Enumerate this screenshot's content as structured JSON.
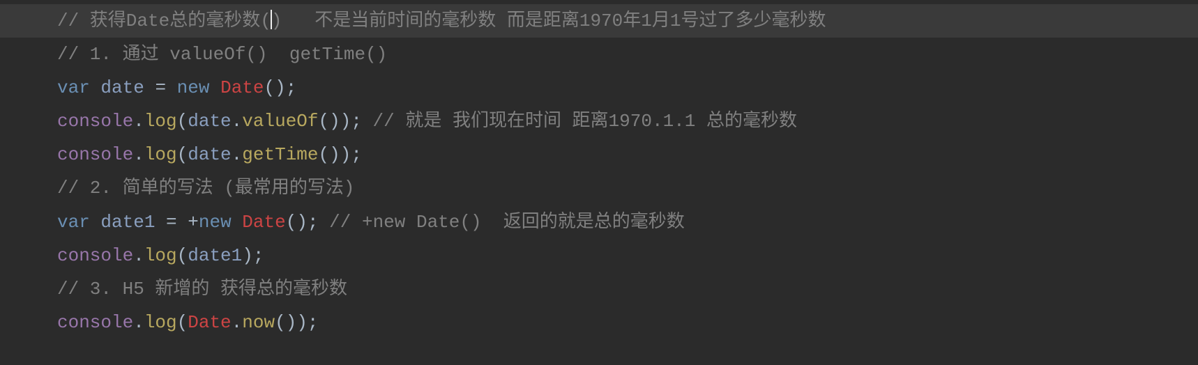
{
  "code": {
    "line1": {
      "c1": "// 获得Date总的毫秒数(",
      "c2": ")   不是当前时间的毫秒数 而是距离1970年1月1号过了多少毫秒数"
    },
    "line2": {
      "comment": "// 1. 通过 valueOf()  getTime()"
    },
    "line3": {
      "kw_var": "var",
      "sp1": " ",
      "name": "date",
      "sp2": " ",
      "eq": "=",
      "sp3": " ",
      "kw_new": "new",
      "sp4": " ",
      "cls": "Date",
      "paren": "()",
      "semi": ";"
    },
    "line4": {
      "obj": "console",
      "dot1": ".",
      "log": "log",
      "open": "(",
      "arg": "date",
      "dot2": ".",
      "method": "valueOf",
      "paren": "()",
      "close": ")",
      "semi": ";",
      "sp": " ",
      "comment": "// 就是 我们现在时间 距离1970.1.1 总的毫秒数"
    },
    "line5": {
      "obj": "console",
      "dot1": ".",
      "log": "log",
      "open": "(",
      "arg": "date",
      "dot2": ".",
      "method": "getTime",
      "paren": "()",
      "close": ")",
      "semi": ";"
    },
    "line6": {
      "comment": "// 2. 简单的写法 (最常用的写法)"
    },
    "line7": {
      "kw_var": "var",
      "sp1": " ",
      "name": "date1",
      "sp2": " ",
      "eq": "=",
      "sp3": " ",
      "plus": "+",
      "kw_new": "new",
      "sp4": " ",
      "cls": "Date",
      "paren": "()",
      "semi": ";",
      "sp5": " ",
      "comment": "// +new Date()  返回的就是总的毫秒数"
    },
    "line8": {
      "obj": "console",
      "dot1": ".",
      "log": "log",
      "open": "(",
      "arg": "date1",
      "close": ")",
      "semi": ";"
    },
    "line9": {
      "comment": "// 3. H5 新增的 获得总的毫秒数"
    },
    "line10": {
      "obj": "console",
      "dot1": ".",
      "log": "log",
      "open": "(",
      "cls": "Date",
      "dot2": ".",
      "method": "now",
      "paren": "()",
      "close": ")",
      "semi": ";"
    }
  }
}
